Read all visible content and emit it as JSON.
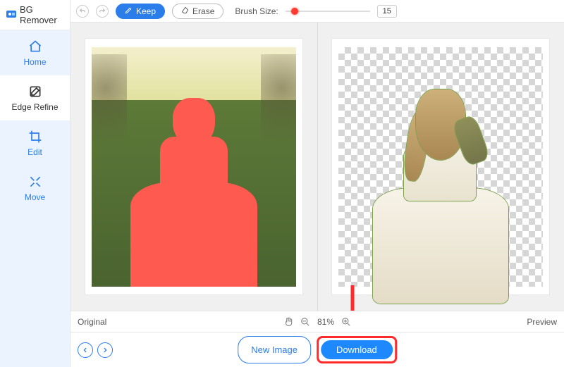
{
  "brand": {
    "title": "BG Remover"
  },
  "sidebar": {
    "items": [
      {
        "label": "Home"
      },
      {
        "label": "Edge Refine"
      },
      {
        "label": "Edit"
      },
      {
        "label": "Move"
      }
    ]
  },
  "toolbar": {
    "keep_label": "Keep",
    "erase_label": "Erase",
    "brush_label": "Brush Size:",
    "brush_value": "15"
  },
  "status": {
    "left_label": "Original",
    "zoom": "81%",
    "right_label": "Preview"
  },
  "footer": {
    "new_image_label": "New Image",
    "download_label": "Download"
  }
}
